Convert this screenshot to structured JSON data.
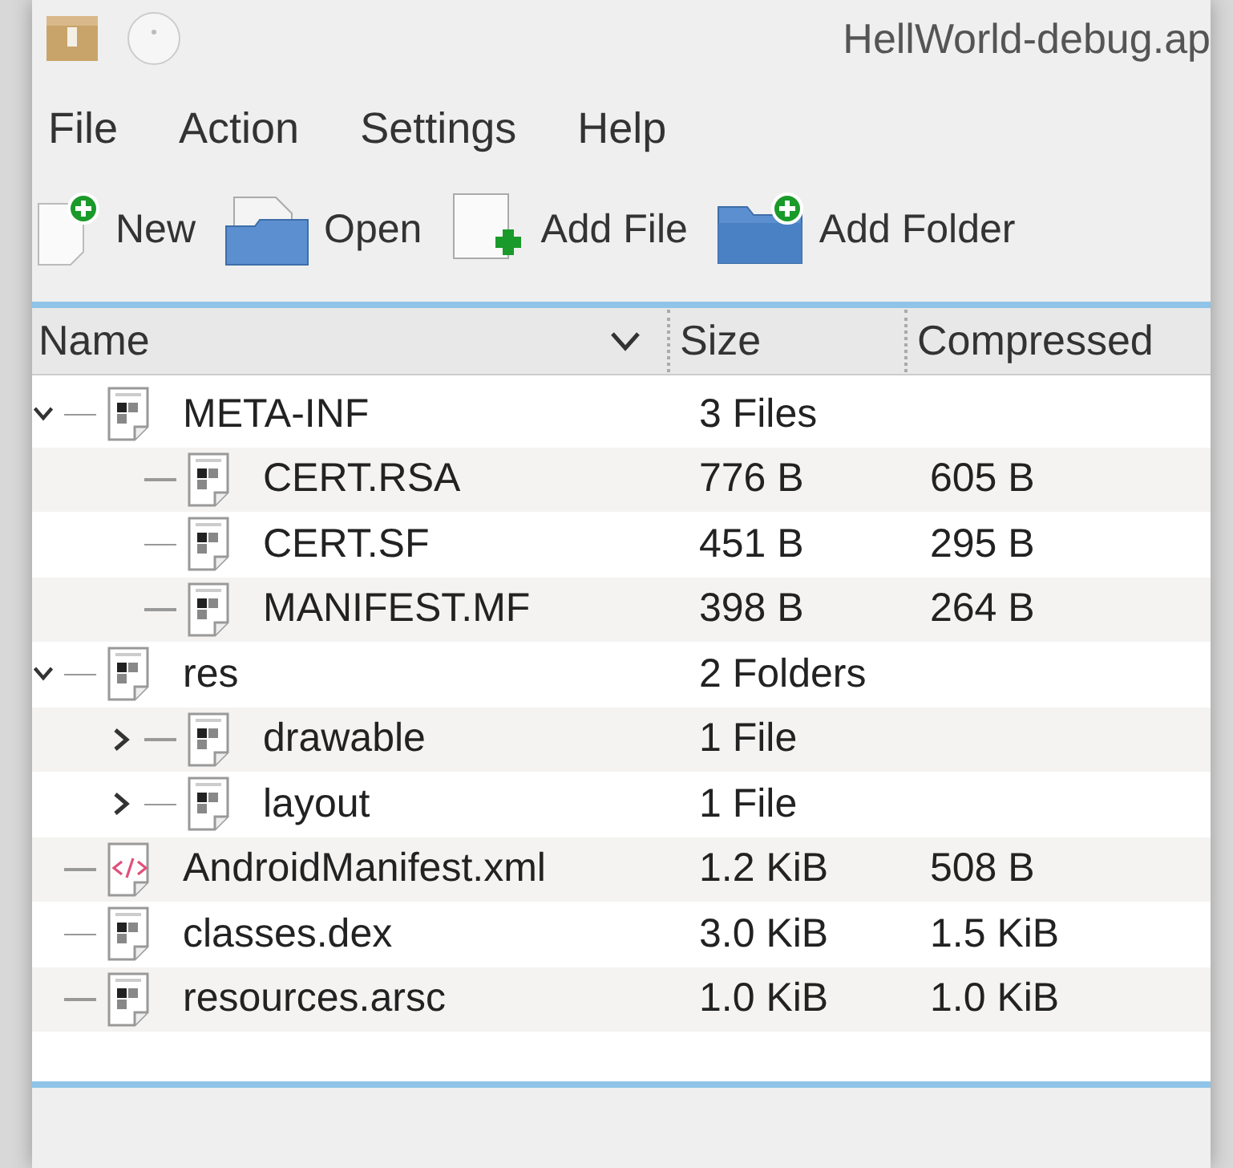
{
  "window": {
    "title": "HellWorld-debug.ap"
  },
  "menu": [
    "File",
    "Action",
    "Settings",
    "Help"
  ],
  "toolbar": [
    {
      "label": "New",
      "kind": "new"
    },
    {
      "label": "Open",
      "kind": "open"
    },
    {
      "label": "Add File",
      "kind": "addfile"
    },
    {
      "label": "Add Folder",
      "kind": "addfolder"
    }
  ],
  "table": {
    "columns": [
      "Name",
      "Size",
      "Compressed"
    ],
    "rows": [
      {
        "name": "META-INF",
        "kind": "binary",
        "size": "3 Files",
        "expanded": true,
        "children": [
          {
            "name": "CERT.RSA",
            "kind": "binary",
            "size": "776 B",
            "compressed": "605 B"
          },
          {
            "name": "CERT.SF",
            "kind": "binary",
            "size": "451 B",
            "compressed": "295 B"
          },
          {
            "name": "MANIFEST.MF",
            "kind": "binary",
            "size": "398 B",
            "compressed": "264 B"
          }
        ]
      },
      {
        "name": "res",
        "kind": "binary",
        "size": "2 Folders",
        "expanded": true,
        "children": [
          {
            "name": "drawable",
            "kind": "binary",
            "size": "1 File",
            "expanded": false
          },
          {
            "name": "layout",
            "kind": "binary",
            "size": "1 File",
            "expanded": false
          }
        ]
      },
      {
        "name": "AndroidManifest.xml",
        "kind": "xml",
        "size": "1.2 KiB",
        "compressed": "508 B"
      },
      {
        "name": "classes.dex",
        "kind": "binary",
        "size": "3.0 KiB",
        "compressed": "1.5 KiB"
      },
      {
        "name": "resources.arsc",
        "kind": "binary",
        "size": "1.0 KiB",
        "compressed": "1.0 KiB"
      }
    ]
  }
}
